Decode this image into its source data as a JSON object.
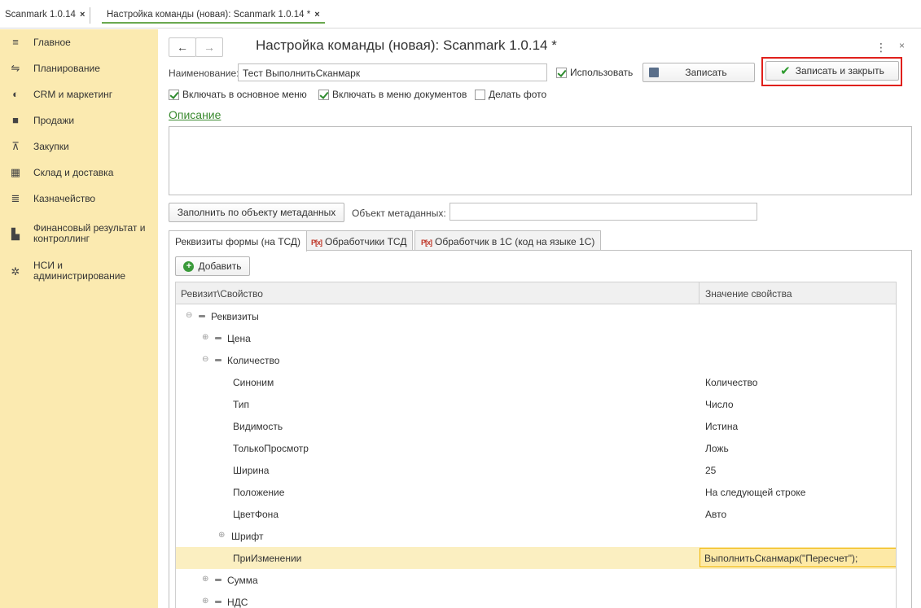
{
  "top_tabs": [
    {
      "label": "Scanmark 1.0.14",
      "close": "×"
    },
    {
      "label": "Настройка команды (новая): Scanmark 1.0.14 *",
      "close": "×"
    }
  ],
  "sidebar": {
    "items": [
      {
        "label": "Главное",
        "icon": "menu-icon"
      },
      {
        "label": "Планирование",
        "icon": "planning-icon"
      },
      {
        "label": "CRM и маркетинг",
        "icon": "crm-icon"
      },
      {
        "label": "Продажи",
        "icon": "sales-bag-icon"
      },
      {
        "label": "Закупки",
        "icon": "cart-icon"
      },
      {
        "label": "Склад и доставка",
        "icon": "warehouse-icon"
      },
      {
        "label": "Казначейство",
        "icon": "treasury-icon"
      },
      {
        "label": "Финансовый результат и контроллинг",
        "icon": "chart-bars-icon"
      },
      {
        "label": "НСИ и администрирование",
        "icon": "gear-icon"
      }
    ]
  },
  "header": {
    "back": "←",
    "forward": "→",
    "title": "Настройка команды (новая): Scanmark 1.0.14 *",
    "more": "⋮",
    "close": "×"
  },
  "form": {
    "name_label": "Наименование:",
    "name_value": "Тест ВыполнитьСканмарк",
    "use_label": "Использовать",
    "use_checked": true,
    "save_label": "Записать",
    "save_close_label": "Записать и закрыть",
    "include_main_menu": "Включать в основное меню",
    "include_docs_menu": "Включать в меню документов",
    "make_photo": "Делать фото",
    "description_link": "Описание",
    "fill_by_metadata": "Заполнить по объекту метаданных",
    "metadata_label": "Объект метаданных:",
    "metadata_value": ""
  },
  "tabs": [
    {
      "label": "Реквизиты формы (на ТСД)",
      "active": true
    },
    {
      "label": "Обработчики ТСД",
      "active": false
    },
    {
      "label": "Обработчик в 1С  (код на языке 1С)",
      "active": false
    }
  ],
  "grid": {
    "add_label": "Добавить",
    "columns": [
      "Ревизит\\Свойство",
      "Значение свойства"
    ],
    "rows": [
      {
        "name": "Реквизиты",
        "value": "",
        "level": 0,
        "toggle": "⊖",
        "dash": true
      },
      {
        "name": "Цена",
        "value": "",
        "level": 1,
        "toggle": "⊕",
        "dash": true
      },
      {
        "name": "Количество",
        "value": "",
        "level": 1,
        "toggle": "⊖",
        "dash": true
      },
      {
        "name": "Синоним",
        "value": "Количество",
        "level": 2,
        "toggle": "",
        "dash": false
      },
      {
        "name": "Тип",
        "value": "Число",
        "level": 2,
        "toggle": "",
        "dash": false
      },
      {
        "name": "Видимость",
        "value": "Истина",
        "level": 2,
        "toggle": "",
        "dash": false
      },
      {
        "name": "ТолькоПросмотр",
        "value": "Ложь",
        "level": 2,
        "toggle": "",
        "dash": false
      },
      {
        "name": "Ширина",
        "value": "25",
        "level": 2,
        "toggle": "",
        "dash": false
      },
      {
        "name": "Положение",
        "value": "На следующей строке",
        "level": 2,
        "toggle": "",
        "dash": false
      },
      {
        "name": "ЦветФона",
        "value": "Авто",
        "level": 2,
        "toggle": "",
        "dash": false
      },
      {
        "name": "Шрифт",
        "value": "",
        "level": 2,
        "toggle": "⊕",
        "dash": false,
        "font_row": true
      },
      {
        "name": "ПриИзменении",
        "value": "ВыполнитьСканмарк(\"Пересчет\");",
        "level": 2,
        "toggle": "",
        "dash": false,
        "selected": true
      },
      {
        "name": "Сумма",
        "value": "",
        "level": 1,
        "toggle": "⊕",
        "dash": true
      },
      {
        "name": "НДС",
        "value": "",
        "level": 1,
        "toggle": "⊕",
        "dash": true
      }
    ]
  },
  "colors": {
    "sidebar_bg": "#fbeab0",
    "accent_green": "#3a8a2f",
    "highlight_red": "#e0201b",
    "selected_row": "#fbefc1"
  }
}
